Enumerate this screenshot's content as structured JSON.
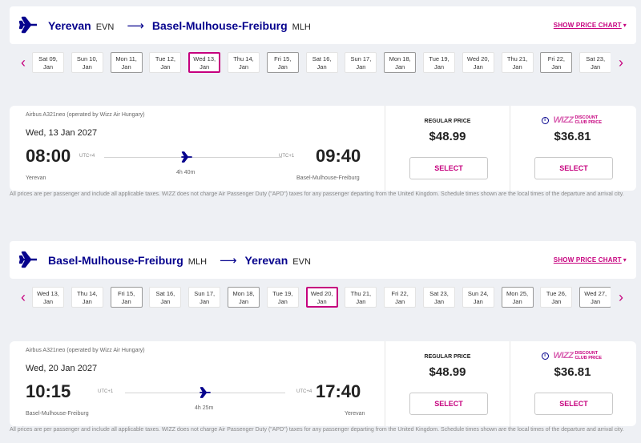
{
  "colors": {
    "accent": "#c6007e",
    "brand_blue": "#06038d"
  },
  "outbound": {
    "route": {
      "from_city": "Yerevan",
      "from_code": "EVN",
      "to_city": "Basel-Mulhouse-Freiburg",
      "to_code": "MLH"
    },
    "price_chart_label": "SHOW PRICE CHART",
    "dates": [
      {
        "day": "Sat 09,",
        "month": "Jan"
      },
      {
        "day": "Sun 10,",
        "month": "Jan"
      },
      {
        "day": "Mon 11,",
        "month": "Jan"
      },
      {
        "day": "Tue 12,",
        "month": "Jan"
      },
      {
        "day": "Wed 13,",
        "month": "Jan"
      },
      {
        "day": "Thu 14,",
        "month": "Jan"
      },
      {
        "day": "Fri 15,",
        "month": "Jan"
      },
      {
        "day": "Sat 16,",
        "month": "Jan"
      },
      {
        "day": "Sun 17,",
        "month": "Jan"
      },
      {
        "day": "Mon 18,",
        "month": "Jan"
      },
      {
        "day": "Tue 19,",
        "month": "Jan"
      },
      {
        "day": "Wed 20,",
        "month": "Jan"
      },
      {
        "day": "Thu 21,",
        "month": "Jan"
      },
      {
        "day": "Fri 22,",
        "month": "Jan"
      },
      {
        "day": "Sat 23,",
        "month": "Jan"
      }
    ],
    "selected_date_index": 4,
    "flight": {
      "aircraft": "Airbus A321neo (operated by Wizz Air Hungary)",
      "date": "Wed, 13 Jan 2027",
      "dep_time": "08:00",
      "dep_tz": "UTC+4",
      "dep_city": "Yerevan",
      "arr_time": "09:40",
      "arr_tz": "UTC+1",
      "arr_city": "Basel-Mulhouse-Freiburg",
      "duration": "4h 40m"
    },
    "regular": {
      "label": "REGULAR PRICE",
      "price": "$48.99",
      "button": "SELECT"
    },
    "club": {
      "logo": "WIZZ",
      "logo_sub": "DISCOUNT CLUB PRICE",
      "price": "$36.81",
      "button": "SELECT"
    }
  },
  "inbound": {
    "route": {
      "from_city": "Basel-Mulhouse-Freiburg",
      "from_code": "MLH",
      "to_city": "Yerevan",
      "to_code": "EVN"
    },
    "price_chart_label": "SHOW PRICE CHART",
    "dates": [
      {
        "day": "Wed 13,",
        "month": "Jan"
      },
      {
        "day": "Thu 14,",
        "month": "Jan"
      },
      {
        "day": "Fri 15,",
        "month": "Jan"
      },
      {
        "day": "Sat 16,",
        "month": "Jan"
      },
      {
        "day": "Sun 17,",
        "month": "Jan"
      },
      {
        "day": "Mon 18,",
        "month": "Jan"
      },
      {
        "day": "Tue 19,",
        "month": "Jan"
      },
      {
        "day": "Wed 20,",
        "month": "Jan"
      },
      {
        "day": "Thu 21,",
        "month": "Jan"
      },
      {
        "day": "Fri 22,",
        "month": "Jan"
      },
      {
        "day": "Sat 23,",
        "month": "Jan"
      },
      {
        "day": "Sun 24,",
        "month": "Jan"
      },
      {
        "day": "Mon 25,",
        "month": "Jan"
      },
      {
        "day": "Tue 26,",
        "month": "Jan"
      },
      {
        "day": "Wed 27,",
        "month": "Jan"
      }
    ],
    "selected_date_index": 7,
    "flight": {
      "aircraft": "Airbus A321neo (operated by Wizz Air Hungary)",
      "date": "Wed, 20 Jan 2027",
      "dep_time": "10:15",
      "dep_tz": "UTC+1",
      "dep_city": "Basel-Mulhouse-Freiburg",
      "arr_time": "17:40",
      "arr_tz": "UTC+4",
      "arr_city": "Yerevan",
      "duration": "4h 25m"
    },
    "regular": {
      "label": "REGULAR PRICE",
      "price": "$48.99",
      "button": "SELECT"
    },
    "club": {
      "logo": "WIZZ",
      "logo_sub": "DISCOUNT CLUB PRICE",
      "price": "$36.81",
      "button": "SELECT"
    }
  },
  "disclaimer": "All prices are per passenger and include all applicable taxes. WIZZ does not charge Air Passenger Duty (\"APD\") taxes for any passenger departing from the United Kingdom. Schedule times shown are the local times of the departure and arrival city.",
  "icons": {
    "prev": "chevron-left-icon",
    "next": "chevron-right-icon",
    "plane": "airplane-icon",
    "info": "info-icon"
  }
}
